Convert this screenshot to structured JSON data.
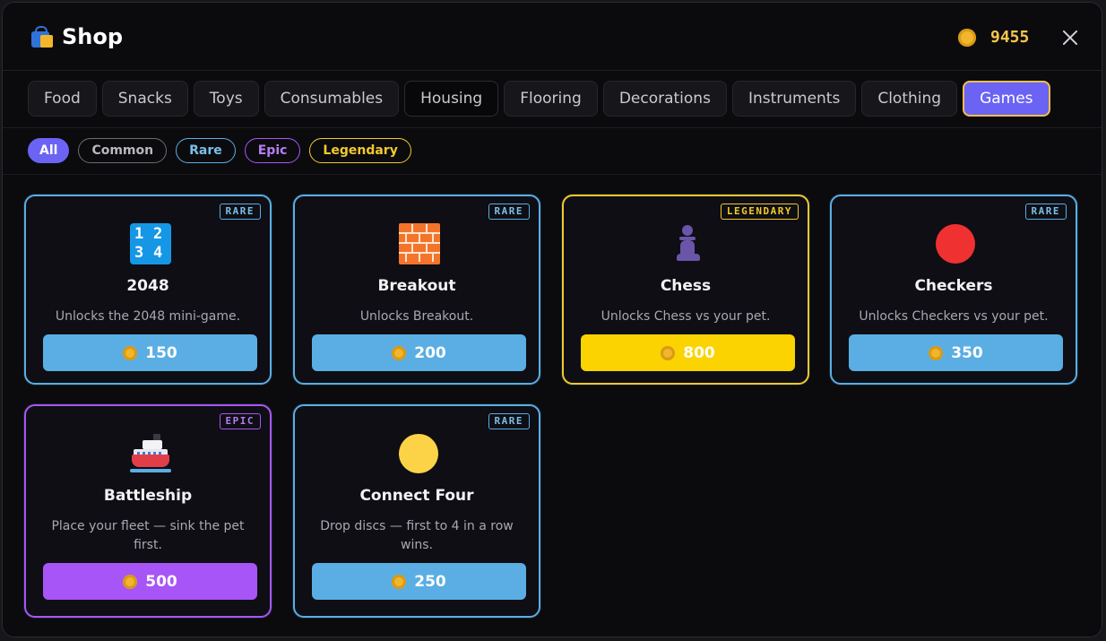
{
  "header": {
    "title": "Shop",
    "coins": "9455"
  },
  "tabs": [
    {
      "label": "Food"
    },
    {
      "label": "Snacks"
    },
    {
      "label": "Toys"
    },
    {
      "label": "Consumables"
    },
    {
      "label": "Housing"
    },
    {
      "label": "Flooring"
    },
    {
      "label": "Decorations"
    },
    {
      "label": "Instruments"
    },
    {
      "label": "Clothing"
    },
    {
      "label": "Games"
    }
  ],
  "active_tab": "Games",
  "filters": [
    {
      "label": "All"
    },
    {
      "label": "Common"
    },
    {
      "label": "Rare"
    },
    {
      "label": "Epic"
    },
    {
      "label": "Legendary"
    }
  ],
  "active_filter": "All",
  "items": [
    {
      "rarity": "RARE",
      "icon": "number-tiles-icon",
      "name": "2048",
      "desc": "Unlocks the 2048 mini-game.",
      "price": "150"
    },
    {
      "rarity": "RARE",
      "icon": "brick-wall-icon",
      "name": "Breakout",
      "desc": "Unlocks Breakout.",
      "price": "200"
    },
    {
      "rarity": "LEGENDARY",
      "icon": "chess-pawn-icon",
      "name": "Chess",
      "desc": "Unlocks Chess vs your pet.",
      "price": "800"
    },
    {
      "rarity": "RARE",
      "icon": "red-circle-icon",
      "name": "Checkers",
      "desc": "Unlocks Checkers vs your pet.",
      "price": "350"
    },
    {
      "rarity": "EPIC",
      "icon": "ship-icon",
      "name": "Battleship",
      "desc": "Place your fleet — sink the pet first.",
      "price": "500"
    },
    {
      "rarity": "RARE",
      "icon": "yellow-circle-icon",
      "name": "Connect Four",
      "desc": "Drop discs — first to 4 in a row wins.",
      "price": "250"
    }
  ],
  "colors": {
    "rare": "#5aaee3",
    "epic": "#a855f7",
    "legendary": "#f3c92b",
    "accent": "#6b63f4",
    "coin": "#f2b62c"
  }
}
